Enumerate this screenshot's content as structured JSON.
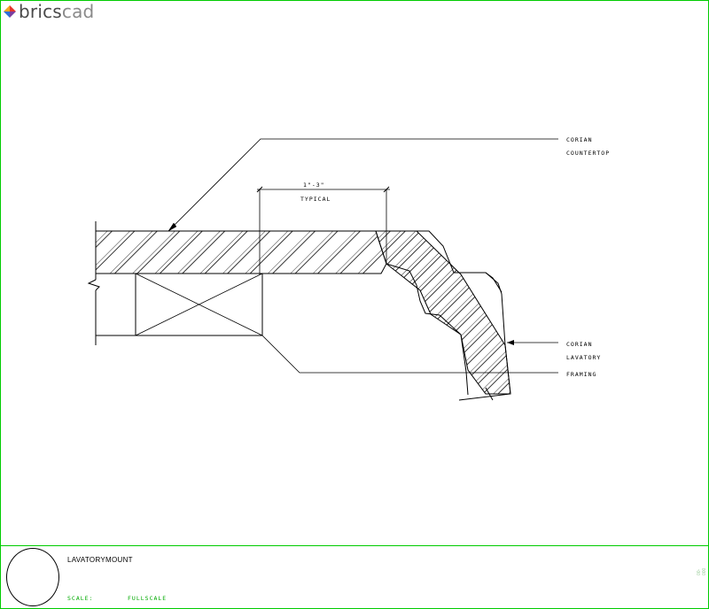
{
  "logo": {
    "part1": "brics",
    "part2": "cad"
  },
  "notes": {
    "countertop_line1": "CORIAN",
    "countertop_line2": "COUNTERTOP",
    "dimension_value": "1\"-3\"",
    "dimension_note": "TYPICAL",
    "lavatory_line1": "CORIAN",
    "lavatory_line2": "LAVATORY",
    "framing": "FRAMING"
  },
  "title_block": {
    "title": "LAVATORYMOUNT",
    "scale_label": "SCALE:",
    "scale_value": "FULLSCALE",
    "code": "00-000"
  },
  "colors": {
    "border": "#00cc00",
    "scale_text": "#00aa00",
    "ink": "#000000"
  }
}
